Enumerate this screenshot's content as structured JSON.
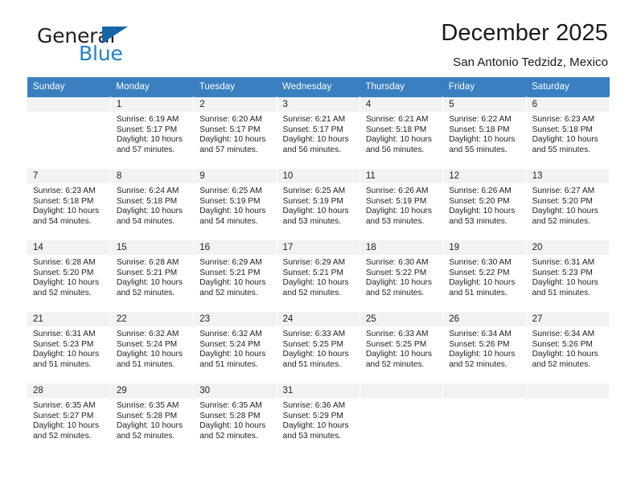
{
  "brand": {
    "name_top": "General",
    "name_bottom": "Blue",
    "triangle_color": "#1565a8",
    "blue_color": "#1e82c8"
  },
  "header": {
    "title": "December 2025",
    "subtitle": "San Antonio Tedzidz, Mexico"
  },
  "theme": {
    "header_bg": "#3a7fc0",
    "daynum_bg": "#f2f2f2",
    "text": "#222222"
  },
  "weekdays": [
    "Sunday",
    "Monday",
    "Tuesday",
    "Wednesday",
    "Thursday",
    "Friday",
    "Saturday"
  ],
  "weeks": [
    [
      {
        "day": "",
        "sunrise": "",
        "sunset": "",
        "daylight": ""
      },
      {
        "day": "1",
        "sunrise": "Sunrise: 6:19 AM",
        "sunset": "Sunset: 5:17 PM",
        "daylight": "Daylight: 10 hours and 57 minutes."
      },
      {
        "day": "2",
        "sunrise": "Sunrise: 6:20 AM",
        "sunset": "Sunset: 5:17 PM",
        "daylight": "Daylight: 10 hours and 57 minutes."
      },
      {
        "day": "3",
        "sunrise": "Sunrise: 6:21 AM",
        "sunset": "Sunset: 5:17 PM",
        "daylight": "Daylight: 10 hours and 56 minutes."
      },
      {
        "day": "4",
        "sunrise": "Sunrise: 6:21 AM",
        "sunset": "Sunset: 5:18 PM",
        "daylight": "Daylight: 10 hours and 56 minutes."
      },
      {
        "day": "5",
        "sunrise": "Sunrise: 6:22 AM",
        "sunset": "Sunset: 5:18 PM",
        "daylight": "Daylight: 10 hours and 55 minutes."
      },
      {
        "day": "6",
        "sunrise": "Sunrise: 6:23 AM",
        "sunset": "Sunset: 5:18 PM",
        "daylight": "Daylight: 10 hours and 55 minutes."
      }
    ],
    [
      {
        "day": "7",
        "sunrise": "Sunrise: 6:23 AM",
        "sunset": "Sunset: 5:18 PM",
        "daylight": "Daylight: 10 hours and 54 minutes."
      },
      {
        "day": "8",
        "sunrise": "Sunrise: 6:24 AM",
        "sunset": "Sunset: 5:18 PM",
        "daylight": "Daylight: 10 hours and 54 minutes."
      },
      {
        "day": "9",
        "sunrise": "Sunrise: 6:25 AM",
        "sunset": "Sunset: 5:19 PM",
        "daylight": "Daylight: 10 hours and 54 minutes."
      },
      {
        "day": "10",
        "sunrise": "Sunrise: 6:25 AM",
        "sunset": "Sunset: 5:19 PM",
        "daylight": "Daylight: 10 hours and 53 minutes."
      },
      {
        "day": "11",
        "sunrise": "Sunrise: 6:26 AM",
        "sunset": "Sunset: 5:19 PM",
        "daylight": "Daylight: 10 hours and 53 minutes."
      },
      {
        "day": "12",
        "sunrise": "Sunrise: 6:26 AM",
        "sunset": "Sunset: 5:20 PM",
        "daylight": "Daylight: 10 hours and 53 minutes."
      },
      {
        "day": "13",
        "sunrise": "Sunrise: 6:27 AM",
        "sunset": "Sunset: 5:20 PM",
        "daylight": "Daylight: 10 hours and 52 minutes."
      }
    ],
    [
      {
        "day": "14",
        "sunrise": "Sunrise: 6:28 AM",
        "sunset": "Sunset: 5:20 PM",
        "daylight": "Daylight: 10 hours and 52 minutes."
      },
      {
        "day": "15",
        "sunrise": "Sunrise: 6:28 AM",
        "sunset": "Sunset: 5:21 PM",
        "daylight": "Daylight: 10 hours and 52 minutes."
      },
      {
        "day": "16",
        "sunrise": "Sunrise: 6:29 AM",
        "sunset": "Sunset: 5:21 PM",
        "daylight": "Daylight: 10 hours and 52 minutes."
      },
      {
        "day": "17",
        "sunrise": "Sunrise: 6:29 AM",
        "sunset": "Sunset: 5:21 PM",
        "daylight": "Daylight: 10 hours and 52 minutes."
      },
      {
        "day": "18",
        "sunrise": "Sunrise: 6:30 AM",
        "sunset": "Sunset: 5:22 PM",
        "daylight": "Daylight: 10 hours and 52 minutes."
      },
      {
        "day": "19",
        "sunrise": "Sunrise: 6:30 AM",
        "sunset": "Sunset: 5:22 PM",
        "daylight": "Daylight: 10 hours and 51 minutes."
      },
      {
        "day": "20",
        "sunrise": "Sunrise: 6:31 AM",
        "sunset": "Sunset: 5:23 PM",
        "daylight": "Daylight: 10 hours and 51 minutes."
      }
    ],
    [
      {
        "day": "21",
        "sunrise": "Sunrise: 6:31 AM",
        "sunset": "Sunset: 5:23 PM",
        "daylight": "Daylight: 10 hours and 51 minutes."
      },
      {
        "day": "22",
        "sunrise": "Sunrise: 6:32 AM",
        "sunset": "Sunset: 5:24 PM",
        "daylight": "Daylight: 10 hours and 51 minutes."
      },
      {
        "day": "23",
        "sunrise": "Sunrise: 6:32 AM",
        "sunset": "Sunset: 5:24 PM",
        "daylight": "Daylight: 10 hours and 51 minutes."
      },
      {
        "day": "24",
        "sunrise": "Sunrise: 6:33 AM",
        "sunset": "Sunset: 5:25 PM",
        "daylight": "Daylight: 10 hours and 51 minutes."
      },
      {
        "day": "25",
        "sunrise": "Sunrise: 6:33 AM",
        "sunset": "Sunset: 5:25 PM",
        "daylight": "Daylight: 10 hours and 52 minutes."
      },
      {
        "day": "26",
        "sunrise": "Sunrise: 6:34 AM",
        "sunset": "Sunset: 5:26 PM",
        "daylight": "Daylight: 10 hours and 52 minutes."
      },
      {
        "day": "27",
        "sunrise": "Sunrise: 6:34 AM",
        "sunset": "Sunset: 5:26 PM",
        "daylight": "Daylight: 10 hours and 52 minutes."
      }
    ],
    [
      {
        "day": "28",
        "sunrise": "Sunrise: 6:35 AM",
        "sunset": "Sunset: 5:27 PM",
        "daylight": "Daylight: 10 hours and 52 minutes."
      },
      {
        "day": "29",
        "sunrise": "Sunrise: 6:35 AM",
        "sunset": "Sunset: 5:28 PM",
        "daylight": "Daylight: 10 hours and 52 minutes."
      },
      {
        "day": "30",
        "sunrise": "Sunrise: 6:35 AM",
        "sunset": "Sunset: 5:28 PM",
        "daylight": "Daylight: 10 hours and 52 minutes."
      },
      {
        "day": "31",
        "sunrise": "Sunrise: 6:36 AM",
        "sunset": "Sunset: 5:29 PM",
        "daylight": "Daylight: 10 hours and 53 minutes."
      },
      {
        "day": "",
        "sunrise": "",
        "sunset": "",
        "daylight": ""
      },
      {
        "day": "",
        "sunrise": "",
        "sunset": "",
        "daylight": ""
      },
      {
        "day": "",
        "sunrise": "",
        "sunset": "",
        "daylight": ""
      }
    ]
  ]
}
